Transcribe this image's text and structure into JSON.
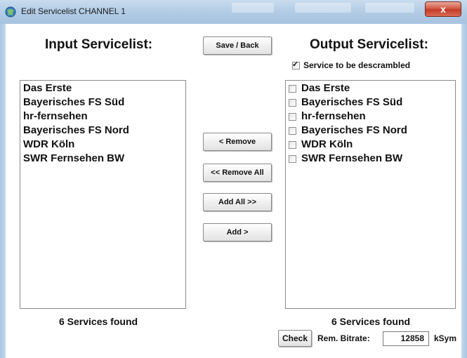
{
  "window": {
    "title": "Edit Servicelist CHANNEL 1",
    "close_label": "x"
  },
  "input": {
    "heading": "Input Servicelist:",
    "items": [
      "Das Erste",
      "Bayerisches FS Süd",
      "hr-fernsehen",
      "Bayerisches FS Nord",
      "WDR Köln",
      "SWR Fernsehen BW"
    ],
    "count_label": "6 Services found"
  },
  "output": {
    "heading": "Output Servicelist:",
    "descramble": {
      "label": "Service to be descrambled",
      "checked": true,
      "mark": "✓"
    },
    "items": [
      {
        "label": "Das Erste",
        "checked": false
      },
      {
        "label": "Bayerisches FS Süd",
        "checked": false
      },
      {
        "label": "hr-fernsehen",
        "checked": false
      },
      {
        "label": "Bayerisches FS Nord",
        "checked": false
      },
      {
        "label": "WDR Köln",
        "checked": false
      },
      {
        "label": "SWR Fernsehen BW",
        "checked": false
      }
    ],
    "count_label": "6 Services found"
  },
  "buttons": {
    "save_back": "Save / Back",
    "remove": "< Remove",
    "remove_all": "<< Remove All",
    "add_all": "Add All >>",
    "add": "Add >",
    "check": "Check"
  },
  "bitrate": {
    "label": "Rem. Bitrate:",
    "value": "12858",
    "unit": "kSym"
  }
}
